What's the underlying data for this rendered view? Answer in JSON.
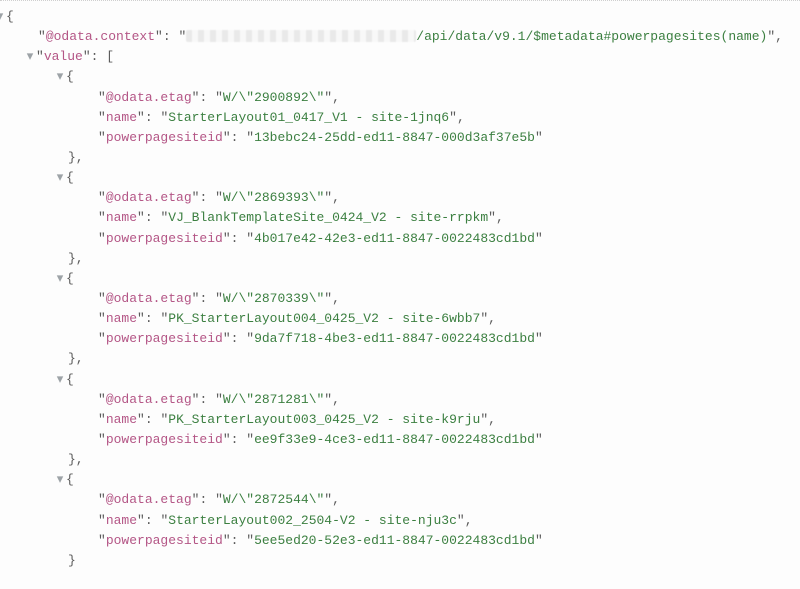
{
  "keys": {
    "context": "@odata.context",
    "value": "value",
    "etag": "@odata.etag",
    "name": "name",
    "siteid": "powerpagesiteid"
  },
  "context_suffix": "/api/data/v9.1/$metadata#powerpagesites(name)",
  "items": [
    {
      "etag": "W/\\\"2900892\\\"",
      "name": "StarterLayout01_0417_V1 - site-1jnq6",
      "powerpagesiteid": "13bebc24-25dd-ed11-8847-000d3af37e5b"
    },
    {
      "etag": "W/\\\"2869393\\\"",
      "name": "VJ_BlankTemplateSite_0424_V2 - site-rrpkm",
      "powerpagesiteid": "4b017e42-42e3-ed11-8847-0022483cd1bd"
    },
    {
      "etag": "W/\\\"2870339\\\"",
      "name": "PK_StarterLayout004_0425_V2 - site-6wbb7",
      "powerpagesiteid": "9da7f718-4be3-ed11-8847-0022483cd1bd"
    },
    {
      "etag": "W/\\\"2871281\\\"",
      "name": "PK_StarterLayout003_0425_V2 - site-k9rju",
      "powerpagesiteid": "ee9f33e9-4ce3-ed11-8847-0022483cd1bd"
    },
    {
      "etag": "W/\\\"2872544\\\"",
      "name": "StarterLayout002_2504-V2 - site-nju3c",
      "powerpagesiteid": "5ee5ed20-52e3-ed11-8847-0022483cd1bd"
    }
  ]
}
